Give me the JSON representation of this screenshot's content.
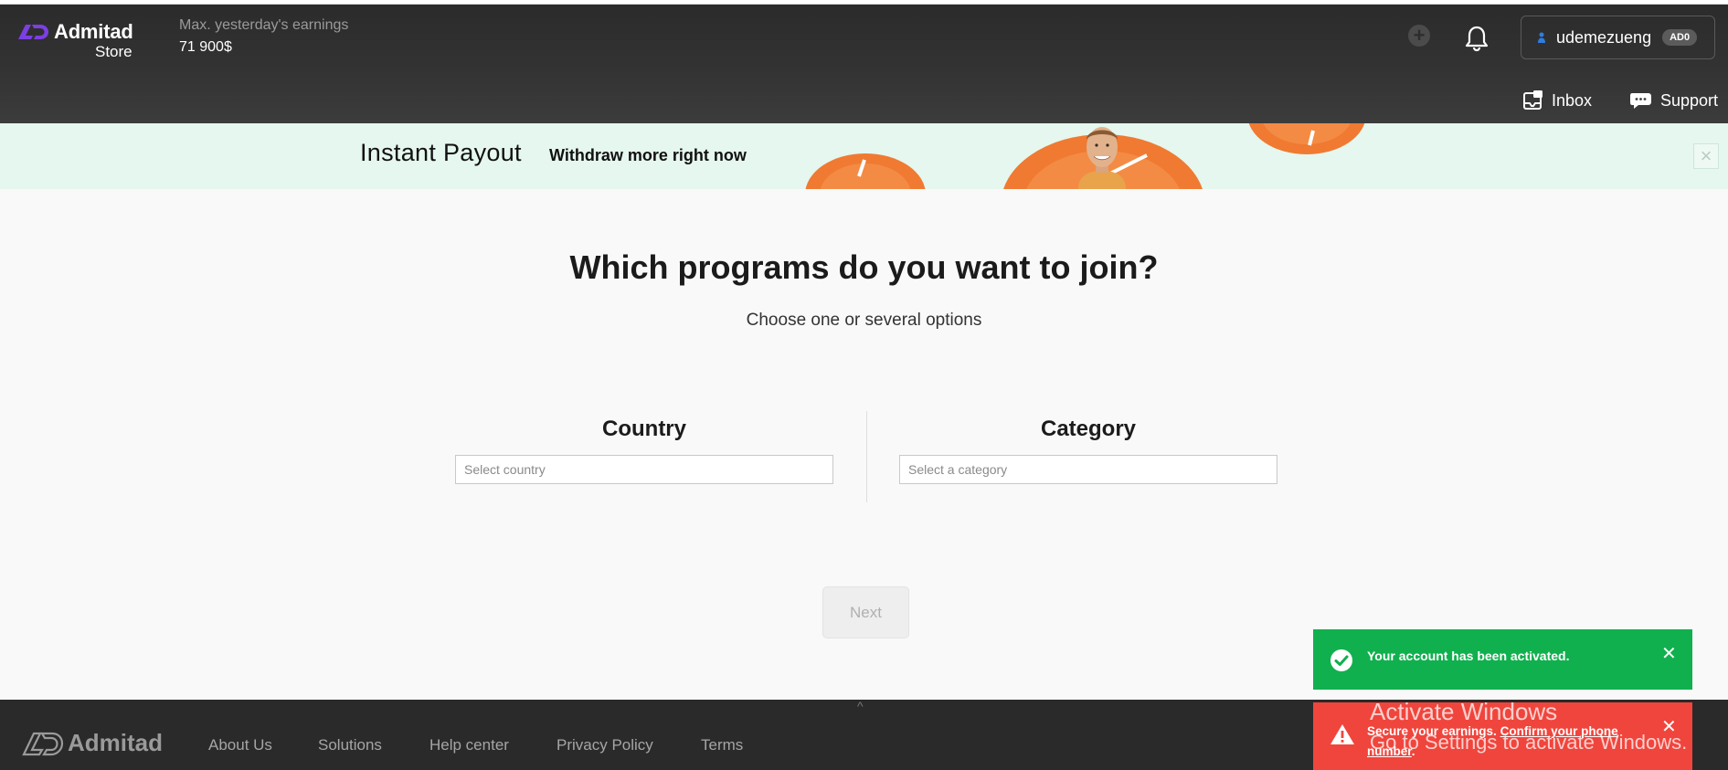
{
  "header": {
    "brand": "Admitad",
    "brand_sub": "Store",
    "earnings_label": "Max. yesterday's earnings",
    "earnings_value": "71 900$",
    "user_name": "udemezueng",
    "user_badge": "AD0",
    "inbox_label": "Inbox",
    "support_label": "Support"
  },
  "banner": {
    "title": "Instant Payout",
    "subtitle": "Withdraw more right now"
  },
  "main": {
    "title": "Which programs do you want to join?",
    "subtitle": "Choose one or several options",
    "country_label": "Country",
    "country_placeholder": "Select country",
    "category_label": "Category",
    "category_placeholder": "Select a category",
    "next_label": "Next"
  },
  "footer": {
    "brand": "Admitad",
    "links": [
      "About Us",
      "Solutions",
      "Help center",
      "Privacy Policy",
      "Terms"
    ]
  },
  "toasts": {
    "success_text": "Your account has been activated.",
    "error_text": "Secure your earnings.",
    "error_link_1": "Confirm your phone",
    "error_link_2": "number",
    "error_link_end": "."
  },
  "watermark": {
    "line1": "Activate Windows",
    "line2": "Go to Settings to activate Windows."
  },
  "colors": {
    "header_bg": "#333333",
    "banner_bg": "#e5f7ee",
    "success": "#11b04e",
    "error": "#f0453c",
    "brand_accent": "#7b3fe4"
  }
}
